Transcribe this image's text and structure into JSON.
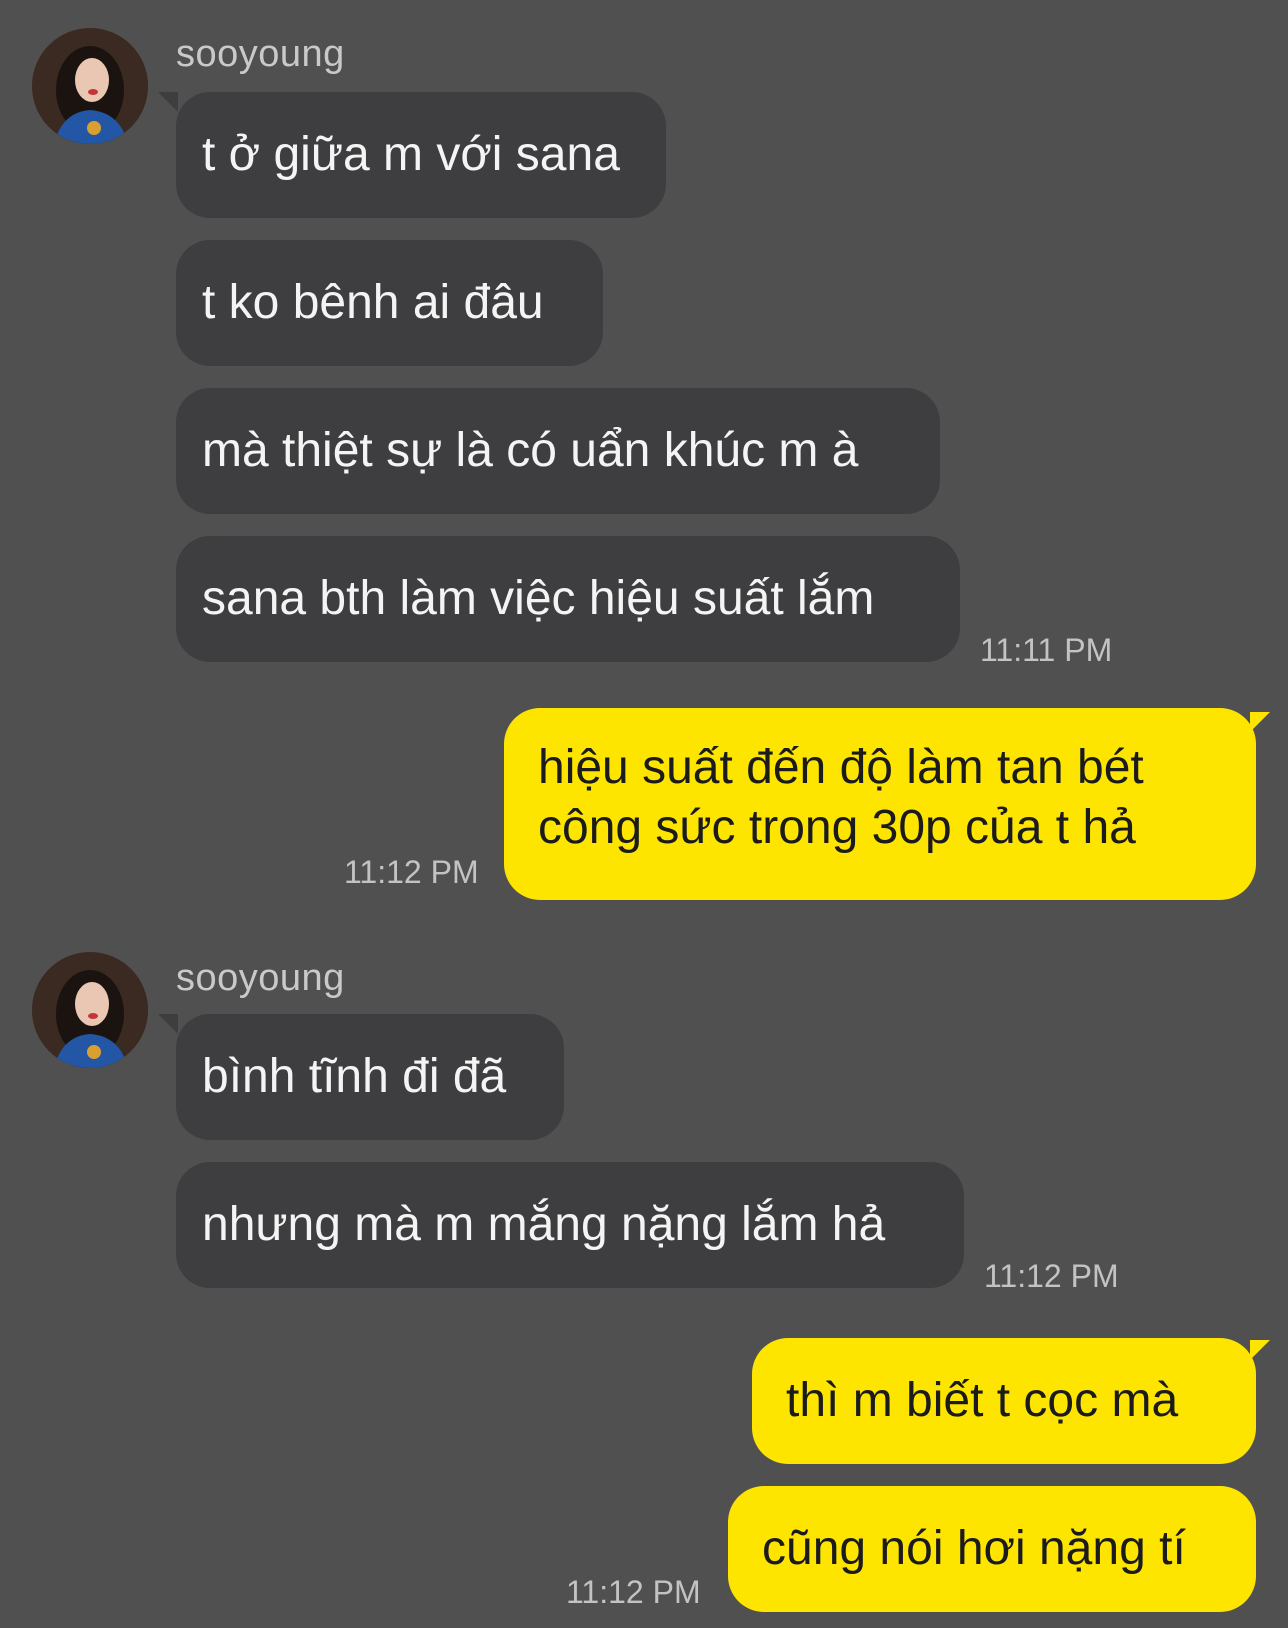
{
  "chat": {
    "messages": [
      {
        "sender": "sooyoung",
        "bubbles": [
          "t ở giữa m với sana",
          "t ko bênh ai đâu",
          "mà thiệt sự là có uẩn khúc m à",
          "sana bth làm việc hiệu suất lắm"
        ],
        "time": "11:11 PM"
      },
      {
        "sender": "me",
        "bubbles": [
          "hiệu suất đến độ làm tan bét công sức trong 30p của t hả"
        ],
        "time": "11:12 PM"
      },
      {
        "sender": "sooyoung",
        "bubbles": [
          "bình tĩnh đi đã",
          "nhưng mà m mắng nặng lắm hả"
        ],
        "time": "11:12 PM"
      },
      {
        "sender": "me",
        "bubbles": [
          "thì m biết t cọc mà",
          "cũng nói hơi nặng tí"
        ],
        "time": "11:12 PM"
      }
    ]
  },
  "colors": {
    "background": "#505050",
    "incoming_bubble": "#3e3e40",
    "outgoing_bubble": "#fee500"
  },
  "icons": {
    "avatar": "profile-photo"
  }
}
